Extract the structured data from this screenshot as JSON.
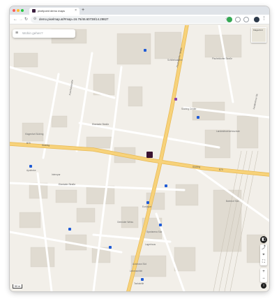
{
  "browser": {
    "tab_title": "pixelpoint demo maps",
    "tab_close": "×",
    "new_tab": "+",
    "url": "demo.pixelmap.at/#map=16.76/46.60738/14.29827",
    "back_icon": "←",
    "forward_icon": "→",
    "reload_icon": "↻",
    "lock_icon": "⊙",
    "star_icon": "☆",
    "menu_icon": "⋮"
  },
  "map": {
    "search_placeholder": "Wohin gehen?",
    "search_menu_icon": "≡",
    "minimap_label": "Klagenfurt",
    "scale_label": "50 m",
    "road_labels": [
      "B70",
      "Südring",
      "B70",
      "Südring",
      "Pischeldorfer Straße",
      "Ebentaler Straße",
      "Ebentaler Straße",
      "Koschutastraße",
      "Feldkirchner Str."
    ],
    "labels": [
      "Schillerkaserne",
      "Pischeldorfer Straße",
      "Südring Center",
      "Klagenfurt Südring",
      "Apotheke",
      "Interspar",
      "Eurospar",
      "Sportarena Süd",
      "Gebrüder Weiss",
      "Lagerhaus",
      "Autohaus Süd",
      "Tankstelle",
      "Lebensmittel",
      "Landesfeuerwehrschule",
      "Bahnhof Süd"
    ],
    "controls": {
      "layers_icon": "◧",
      "share_icon": "⤴",
      "locate_icon": "⌖",
      "fullscreen_icon": "⛶",
      "zoom_in": "+",
      "zoom_out": "−",
      "compass_icon": "▲",
      "info_icon": "i"
    }
  },
  "colors": {
    "accent_marker": "#3a1230",
    "road_major": "#f7d27a",
    "background": "#f2efe9",
    "building": "#e0dbd1"
  }
}
